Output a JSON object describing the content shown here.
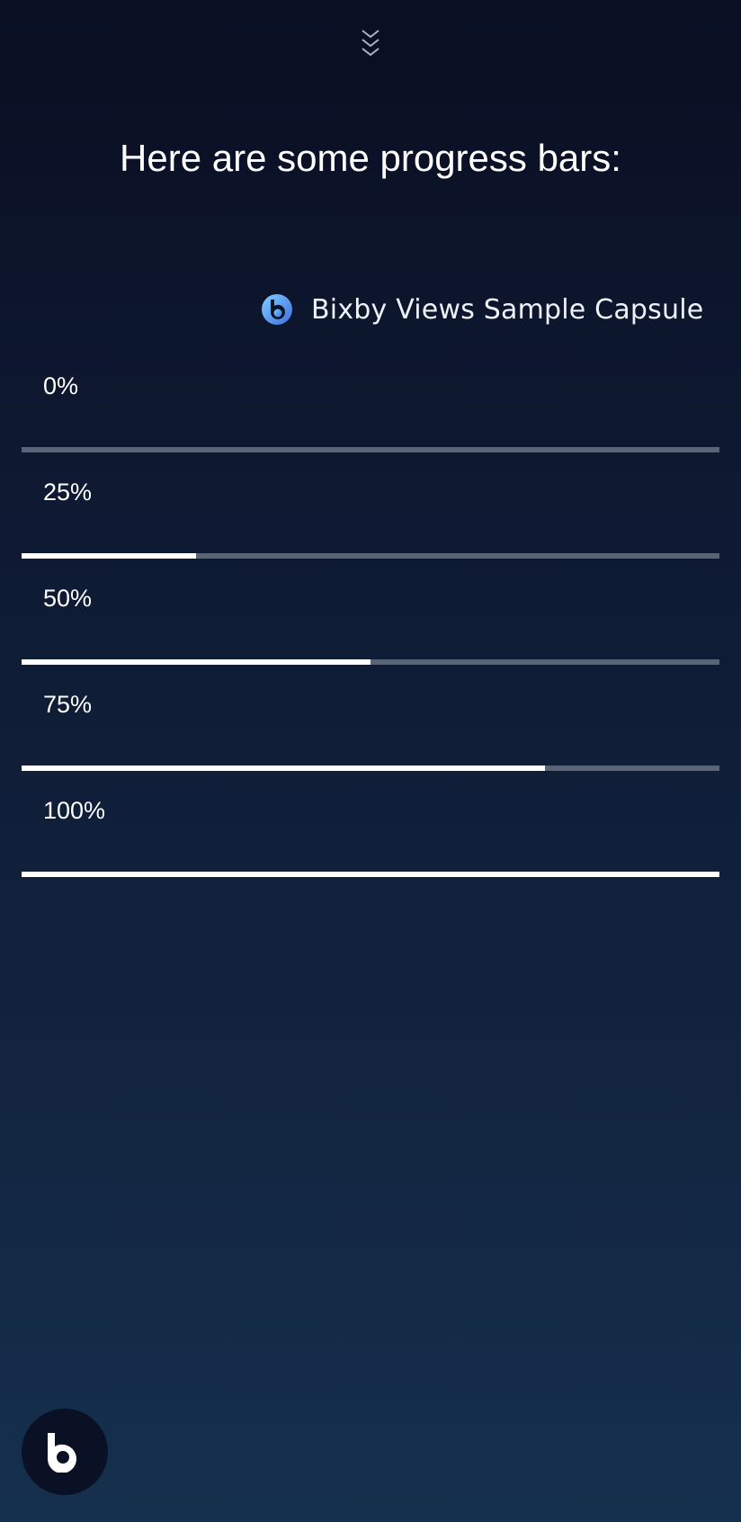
{
  "header": {
    "collapse_icon": "triple-chevron-down-icon"
  },
  "headline": "Here are some progress bars:",
  "capsule": {
    "icon": "bixby-capsule-icon",
    "name": "Bixby Views Sample Capsule"
  },
  "progress_bars": [
    {
      "label": "0%",
      "value": 0
    },
    {
      "label": "25%",
      "value": 0.25
    },
    {
      "label": "50%",
      "value": 0.5
    },
    {
      "label": "75%",
      "value": 0.75
    },
    {
      "label": "100%",
      "value": 1
    }
  ],
  "colors": {
    "background_top": "#0a0f22",
    "background_bottom": "#15304e",
    "track": "#5a6477",
    "fill": "#ffffff",
    "text": "#ffffff"
  },
  "footer": {
    "bixby_button_icon": "bixby-logo-icon"
  }
}
